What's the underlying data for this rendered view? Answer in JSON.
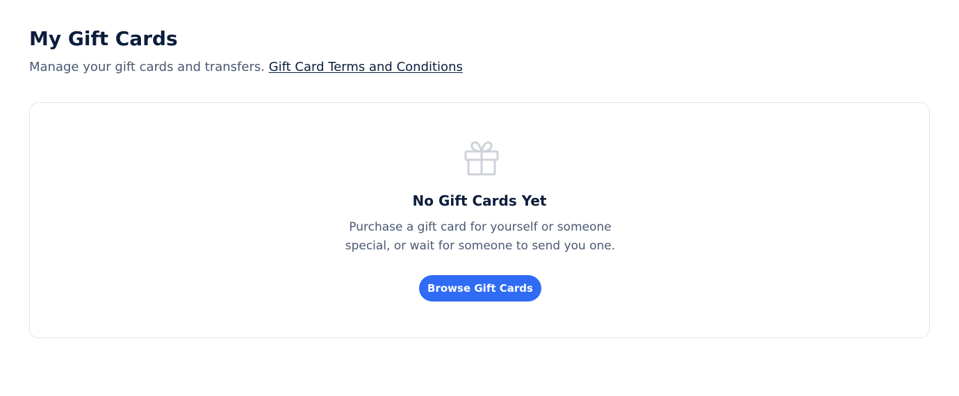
{
  "header": {
    "title": "My Gift Cards",
    "subtitle": "Manage your gift cards and transfers.",
    "terms_link": "Gift Card Terms and Conditions"
  },
  "empty_state": {
    "icon": "gift-icon",
    "title": "No Gift Cards Yet",
    "description": "Purchase a gift card for yourself or someone special, or wait for someone to send you one.",
    "button_label": "Browse Gift Cards"
  },
  "colors": {
    "primary": "#2f6bf5",
    "heading": "#0c1d3b",
    "muted_text": "#4a5871",
    "icon": "#cdd2da",
    "card_border": "#e2e5ea"
  }
}
